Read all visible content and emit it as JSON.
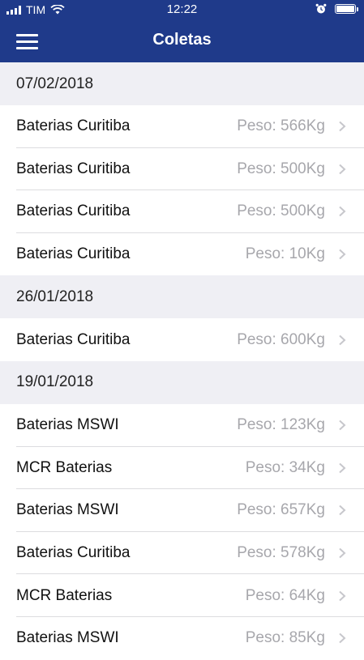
{
  "status_bar": {
    "carrier": "TIM",
    "time": "12:22"
  },
  "navbar": {
    "title": "Coletas"
  },
  "sections": [
    {
      "date": "07/02/2018",
      "items": [
        {
          "name": "Baterias Curitiba",
          "weight": "Peso: 566Kg"
        },
        {
          "name": "Baterias Curitiba",
          "weight": "Peso: 500Kg"
        },
        {
          "name": "Baterias Curitiba",
          "weight": "Peso: 500Kg"
        },
        {
          "name": "Baterias Curitiba",
          "weight": "Peso: 10Kg"
        }
      ]
    },
    {
      "date": "26/01/2018",
      "items": [
        {
          "name": "Baterias Curitiba",
          "weight": "Peso: 600Kg"
        }
      ]
    },
    {
      "date": "19/01/2018",
      "items": [
        {
          "name": "Baterias MSWI",
          "weight": "Peso: 123Kg"
        },
        {
          "name": "MCR Baterias",
          "weight": "Peso: 34Kg"
        },
        {
          "name": "Baterias MSWI",
          "weight": "Peso: 657Kg"
        },
        {
          "name": "Baterias Curitiba",
          "weight": "Peso: 578Kg"
        },
        {
          "name": "MCR Baterias",
          "weight": "Peso: 64Kg"
        },
        {
          "name": "Baterias MSWI",
          "weight": "Peso: 85Kg"
        }
      ]
    }
  ],
  "colors": {
    "nav_background": "#1f3a8a",
    "section_background": "#efeff4",
    "weight_text": "#a7a7ac"
  }
}
